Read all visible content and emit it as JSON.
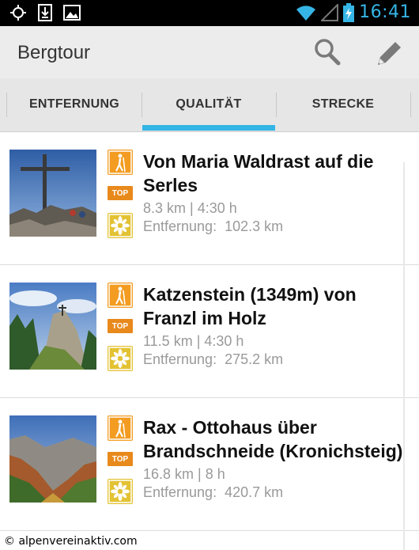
{
  "status_bar": {
    "time": "16:41",
    "icons": [
      "gps-icon",
      "download-icon",
      "image-icon",
      "wifi-icon",
      "signal-icon",
      "battery-charging-icon"
    ]
  },
  "action_bar": {
    "title": "Bergtour",
    "actions": [
      "search-icon",
      "edit-pencil-icon"
    ]
  },
  "tabs": [
    {
      "label": "ENTFERNUNG",
      "selected": false
    },
    {
      "label": "QUALITÄT",
      "selected": true
    },
    {
      "label": "STRECKE",
      "selected": false
    }
  ],
  "colors": {
    "accent": "#33b5e5",
    "badge_orange": "#f39c21",
    "badge_yellow": "#e3c233"
  },
  "tours": [
    {
      "title": "Von Maria Waldrast auf die Serles",
      "stats": "8.3 km | 4:30 h",
      "distance": "Entfernung:  102.3 km",
      "top_label": "TOP",
      "badges": [
        "hiking-icon",
        "top-badge",
        "edelweiss-icon"
      ]
    },
    {
      "title": "Katzenstein (1349m) von Franzl im Holz",
      "stats": "11.5 km | 4:30 h",
      "distance": "Entfernung:  275.2 km",
      "top_label": "TOP",
      "badges": [
        "hiking-icon",
        "top-badge",
        "edelweiss-icon"
      ]
    },
    {
      "title": "Rax - Ottohaus über Brandschneide (Kronichsteig)",
      "stats": "16.8 km | 8 h",
      "distance": "Entfernung:  420.7 km",
      "top_label": "TOP",
      "badges": [
        "hiking-icon",
        "top-badge",
        "edelweiss-icon"
      ]
    }
  ],
  "footer": {
    "copyright": "© alpenvereinaktiv.com"
  }
}
